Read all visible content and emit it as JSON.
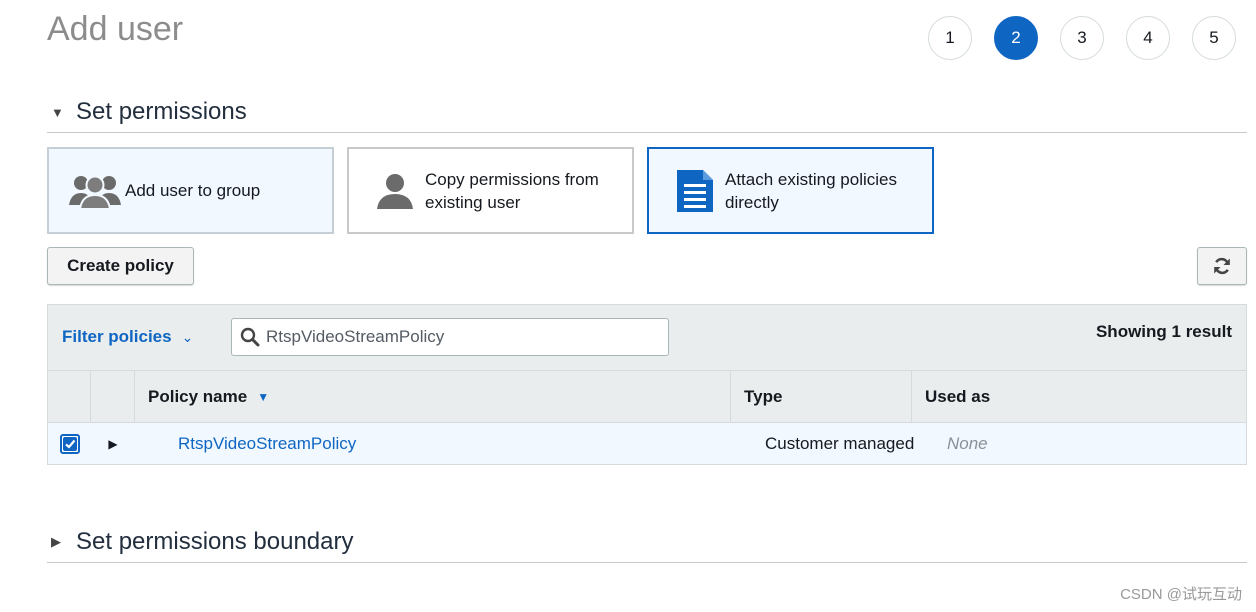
{
  "page": {
    "title": "Add user"
  },
  "steps": [
    {
      "label": "1",
      "active": false
    },
    {
      "label": "2",
      "active": true
    },
    {
      "label": "3",
      "active": false
    },
    {
      "label": "4",
      "active": false
    },
    {
      "label": "5",
      "active": false
    }
  ],
  "permissions_section": {
    "title": "Set permissions",
    "expanded": true
  },
  "options": [
    {
      "label": "Add user to group",
      "icon": "users-group-icon",
      "state": "default"
    },
    {
      "label": "Copy permissions from existing user",
      "icon": "user-icon",
      "state": "default"
    },
    {
      "label": "Attach existing policies directly",
      "icon": "document-icon",
      "state": "selected"
    }
  ],
  "toolbar": {
    "create_policy_label": "Create policy",
    "refresh_icon": "refresh-icon"
  },
  "filter": {
    "label": "Filter policies",
    "search_value": "RtspVideoStreamPolicy",
    "result_text": "Showing 1 result"
  },
  "table": {
    "columns": [
      "Policy name",
      "Type",
      "Used as"
    ],
    "sort_column": "Policy name",
    "rows": [
      {
        "checked": true,
        "name": "RtspVideoStreamPolicy",
        "type": "Customer managed",
        "used_as": "None"
      }
    ]
  },
  "boundary_section": {
    "title": "Set permissions boundary",
    "expanded": false
  },
  "watermark": "CSDN @试玩互动",
  "colors": {
    "accent": "#0f66c2",
    "selected_bg": "#f1f8ff",
    "header_bg": "#eaeded"
  }
}
